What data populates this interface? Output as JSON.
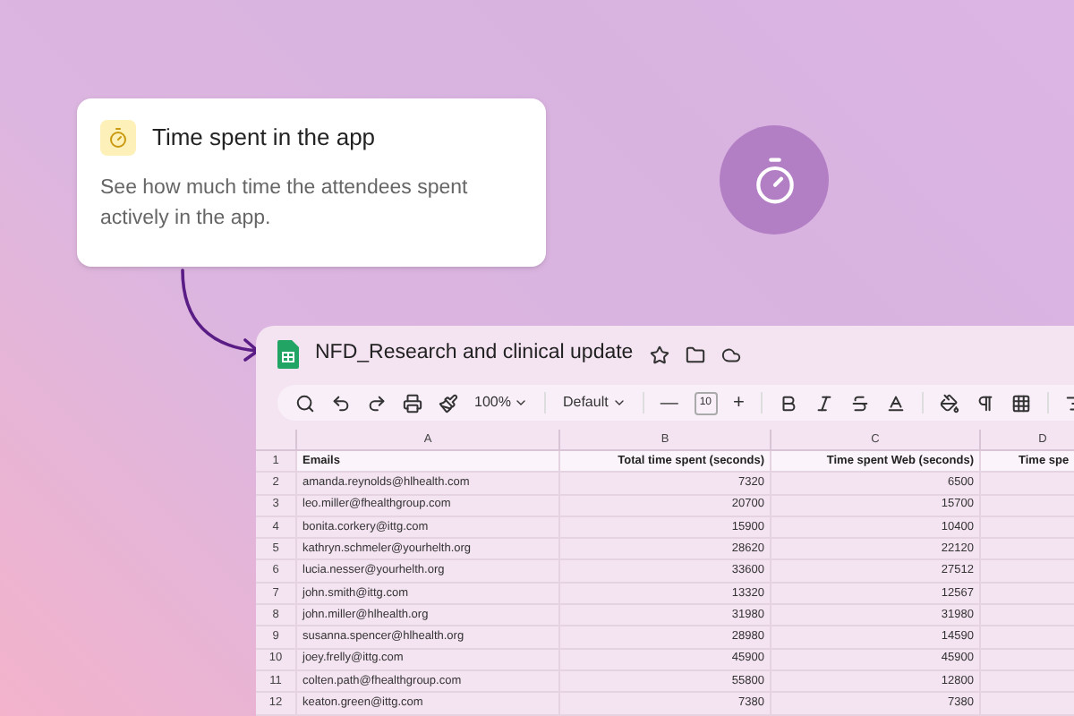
{
  "card": {
    "title": "Time spent in the app",
    "description": "See how much time the attendees spent actively in the app."
  },
  "sheet": {
    "title": "NFD_Research and clinical update",
    "toolbar": {
      "zoom": "100%",
      "font": "Default",
      "font_size": "10",
      "minus": "—",
      "plus": "+"
    },
    "columns": [
      "A",
      "B",
      "C",
      "D"
    ],
    "rows": [
      {
        "number": "1",
        "cells": [
          "Emails",
          "Total time spent (seconds)",
          "Time spent Web (seconds)",
          "Time spe"
        ]
      },
      {
        "number": "2",
        "cells": [
          "amanda.reynolds@hlhealth.com",
          "7320",
          "6500",
          ""
        ]
      },
      {
        "number": "3",
        "cells": [
          "leo.miller@fhealthgroup.com",
          "20700",
          "15700",
          ""
        ]
      },
      {
        "number": "4",
        "cells": [
          "bonita.corkery@ittg.com",
          "15900",
          "10400",
          ""
        ]
      },
      {
        "number": "5",
        "cells": [
          "kathryn.schmeler@yourhelth.org",
          "28620",
          "22120",
          ""
        ]
      },
      {
        "number": "6",
        "cells": [
          "lucia.nesser@yourhelth.org",
          "33600",
          "27512",
          ""
        ]
      },
      {
        "number": "7",
        "cells": [
          "john.smith@ittg.com",
          "13320",
          "12567",
          ""
        ]
      },
      {
        "number": "8",
        "cells": [
          "john.miller@hlhealth.org",
          "31980",
          "31980",
          ""
        ]
      },
      {
        "number": "9",
        "cells": [
          "susanna.spencer@hlhealth.org",
          "28980",
          "14590",
          ""
        ]
      },
      {
        "number": "10",
        "cells": [
          "joey.frelly@ittg.com",
          "45900",
          "45900",
          ""
        ]
      },
      {
        "number": "11",
        "cells": [
          "colten.path@fhealthgroup.com",
          "55800",
          "12800",
          ""
        ]
      },
      {
        "number": "12",
        "cells": [
          "keaton.green@ittg.com",
          "7380",
          "7380",
          ""
        ]
      }
    ]
  }
}
